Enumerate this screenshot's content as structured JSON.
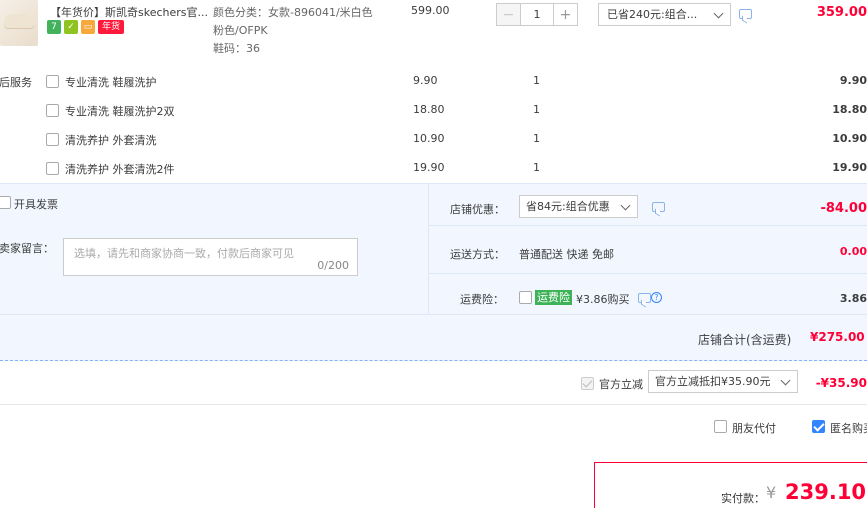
{
  "product": {
    "title": "【年货价】斯凯奇skechers官...",
    "badges": [
      "7",
      "",
      "",
      "年货"
    ],
    "sku_lines": [
      "颜色分类：女款-896041/米白色",
      "粉色/OFPK",
      "鞋码：36"
    ],
    "price": "599.00",
    "quantity": "1",
    "promo": "已省240元:组合...",
    "subtotal": "359.00"
  },
  "services": {
    "label": "售后服务",
    "items": [
      {
        "name": "专业清洗 鞋履洗护",
        "price": "9.90",
        "qty": "1",
        "total": "9.90"
      },
      {
        "name": "专业清洗 鞋履洗护2双",
        "price": "18.80",
        "qty": "1",
        "total": "18.80"
      },
      {
        "name": "清洗养护 外套清洗",
        "price": "10.90",
        "qty": "1",
        "total": "10.90"
      },
      {
        "name": "清洗养护 外套清洗2件",
        "price": "19.90",
        "qty": "1",
        "total": "19.90"
      }
    ]
  },
  "order": {
    "invoice_label": "开具发票",
    "message_label": "给卖家留言：",
    "message_placeholder": "选填，请先和商家协商一致，付款后商家可见",
    "message_count": "0/200",
    "shop_discount_label": "店铺优惠：",
    "shop_discount_select": "省84元:组合优惠",
    "shop_discount_value": "-84.00",
    "shipping_label": "运送方式：",
    "shipping_value": "普通配送 快递 免邮",
    "shipping_cost": "0.00",
    "insurance_label": "运费险：",
    "insurance_badge": "运费险",
    "insurance_desc": "¥3.86购买",
    "insurance_cost": "3.86",
    "shop_total_label": "店铺合计(含运费)",
    "shop_total_value": "¥275.00"
  },
  "official": {
    "label": "官方立减",
    "select": "官方立减抵扣¥35.90元",
    "value": "-¥35.90"
  },
  "options": {
    "friend_pay": "朋友代付",
    "anonymous": "匿名购买"
  },
  "payment": {
    "label": "实付款：",
    "currency": "¥",
    "amount": "239.10"
  },
  "colors": {
    "accent": "#ff0036",
    "panel": "#f2f7ff",
    "checkbox": "#3385ff"
  }
}
